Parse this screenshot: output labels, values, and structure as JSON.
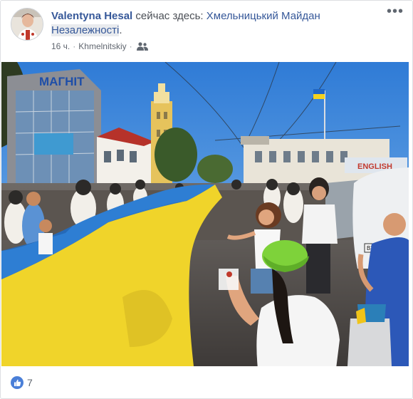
{
  "post": {
    "author": "Valentyna Hesal",
    "status_prefix": "сейчас здесь:",
    "place_line1": "Хмельницький Майдан",
    "place_line2": "Незалежності",
    "place_suffix": ".",
    "time": "16 ч.",
    "separator": "·",
    "location": "Khmelnitskiy",
    "audience_icon": "friends-icon",
    "more_icon": "more-options-icon",
    "more_label": "•••"
  },
  "photo": {
    "signs": {
      "store_sign": "МАГНІТ",
      "school_sign": "ENGLISH",
      "car_plate": "BX 7..."
    },
    "colors": {
      "sky": "#3d8be0",
      "flag_blue": "#2e7ed3",
      "flag_yellow": "#f0d42a",
      "building_tower": "#e7c45f"
    }
  },
  "reactions": {
    "icon": "like-icon",
    "count": "7"
  }
}
